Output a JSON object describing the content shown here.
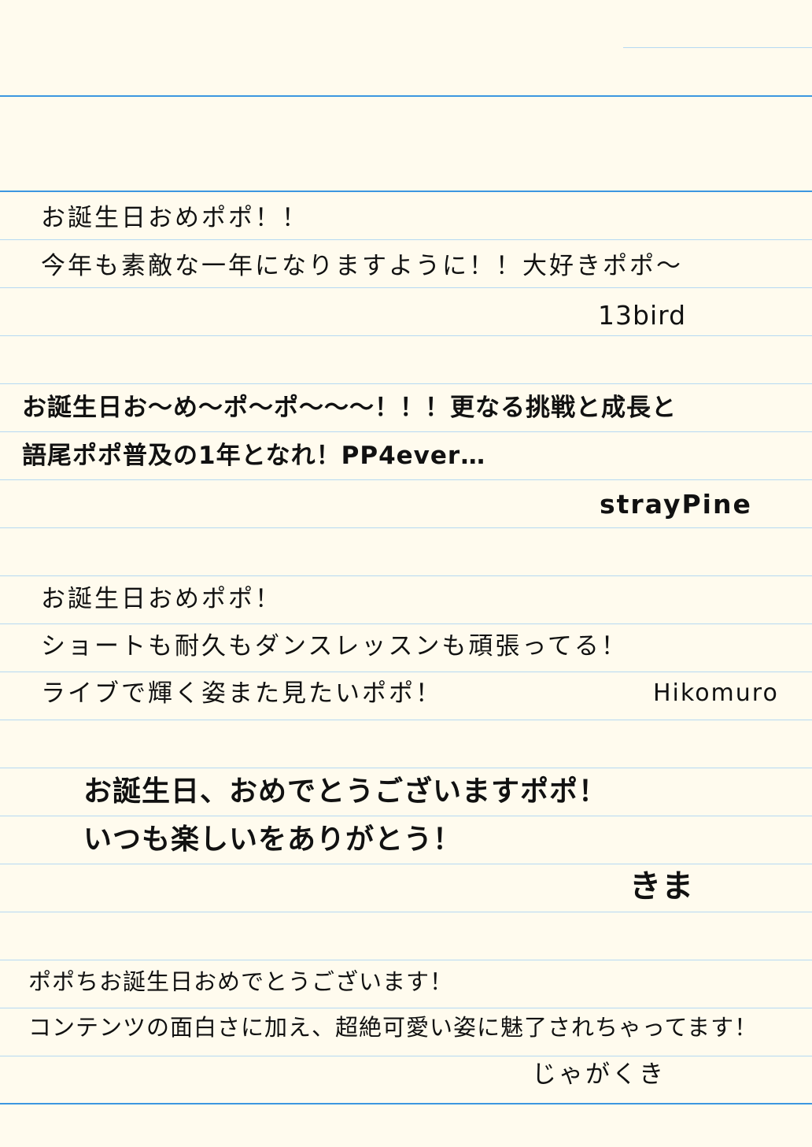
{
  "colors": {
    "paper": "#fffbee",
    "rule_light": "#b5d9f2",
    "rule_strong": "#3d97e0",
    "ink": "#111111"
  },
  "messages": [
    {
      "lines": [
        "お誕生日おめポポ！！",
        "今年も素敵な一年になりますように！！大好きポポ～"
      ],
      "signature": "13bird"
    },
    {
      "lines": [
        "お誕生日お～め～ポ～ポ～～～！！！更なる挑戦と成長と",
        "語尾ポポ普及の1年となれ！PP4ever…"
      ],
      "signature": "strayPine"
    },
    {
      "lines": [
        "お誕生日おめポポ！",
        "ショートも耐久もダンスレッスンも頑張ってる！",
        "ライブで輝く姿また見たいポポ！"
      ],
      "signature": "Hikomuro"
    },
    {
      "lines": [
        "お誕生日、おめでとうございますポポ！",
        "いつも楽しいをありがとう！"
      ],
      "signature": "きま"
    },
    {
      "lines": [
        "ポポちお誕生日おめでとうございます！",
        "コンテンツの面白さに加え、超絶可愛い姿に魅了されちゃってます！"
      ],
      "signature": "じゃがくき"
    }
  ]
}
